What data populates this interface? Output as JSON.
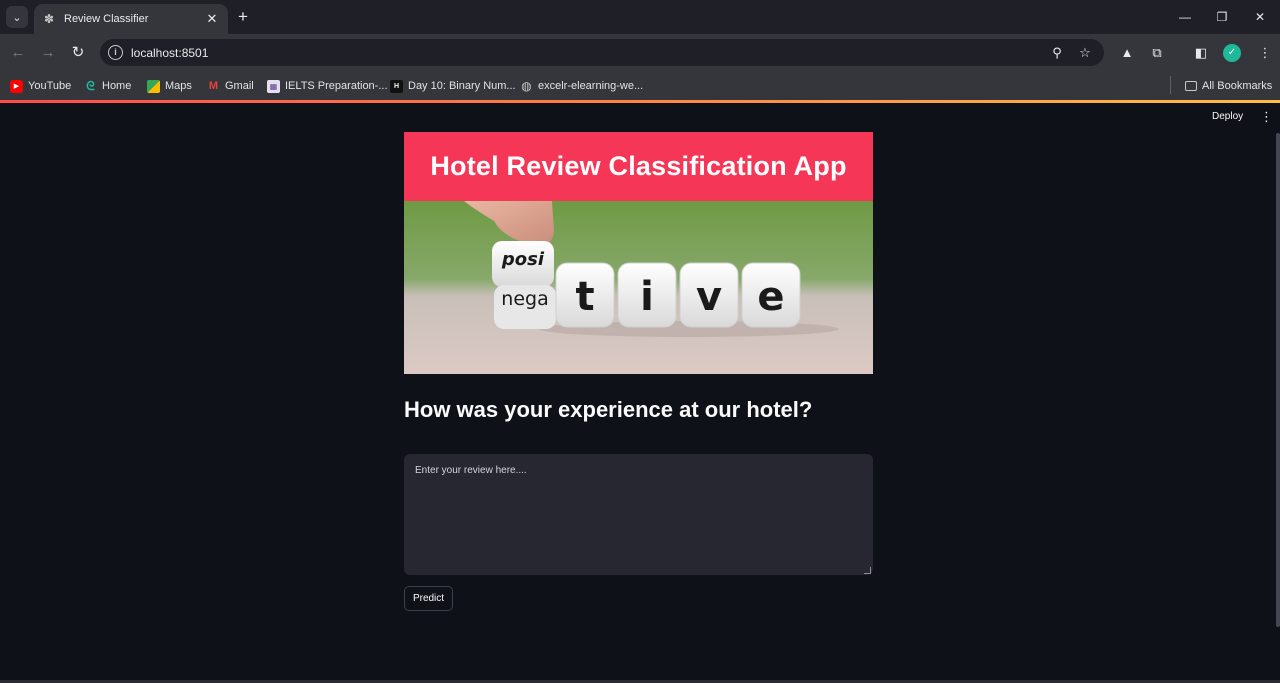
{
  "browser": {
    "tab_title": "Review Classifier",
    "url": "localhost:8501",
    "bookmarks": [
      {
        "label": "YouTube",
        "icon": "youtube-icon",
        "color": "#ff0000"
      },
      {
        "label": "Home",
        "icon": "home-icon",
        "color": "#1fb99a"
      },
      {
        "label": "Maps",
        "icon": "maps-icon",
        "color": "#34a853"
      },
      {
        "label": "Gmail",
        "icon": "gmail-icon",
        "color": "#ea4335"
      },
      {
        "label": "IELTS Preparation-...",
        "icon": "ielts-icon",
        "color": "#8c6bb1"
      },
      {
        "label": "Day 10: Binary Num...",
        "icon": "hackerrank-icon",
        "color": "#111111"
      },
      {
        "label": "excelr-elearning-we...",
        "icon": "globe-icon",
        "color": "#c8c8c8"
      }
    ],
    "all_bookmarks": "All Bookmarks"
  },
  "app": {
    "deploy_label": "Deploy",
    "title": "Hotel Review Classification App",
    "hero_image": {
      "dice_top": "posi",
      "dice_bottom": "nega",
      "dice_letters": [
        "t",
        "i",
        "v",
        "e"
      ]
    },
    "subheading": "How was your experience at our hotel?",
    "review_placeholder": "Enter your review here....",
    "predict_label": "Predict"
  },
  "colors": {
    "app_bg": "#0e1117",
    "banner_red": "#f63656",
    "input_bg": "#262730",
    "text": "#fafafa"
  }
}
